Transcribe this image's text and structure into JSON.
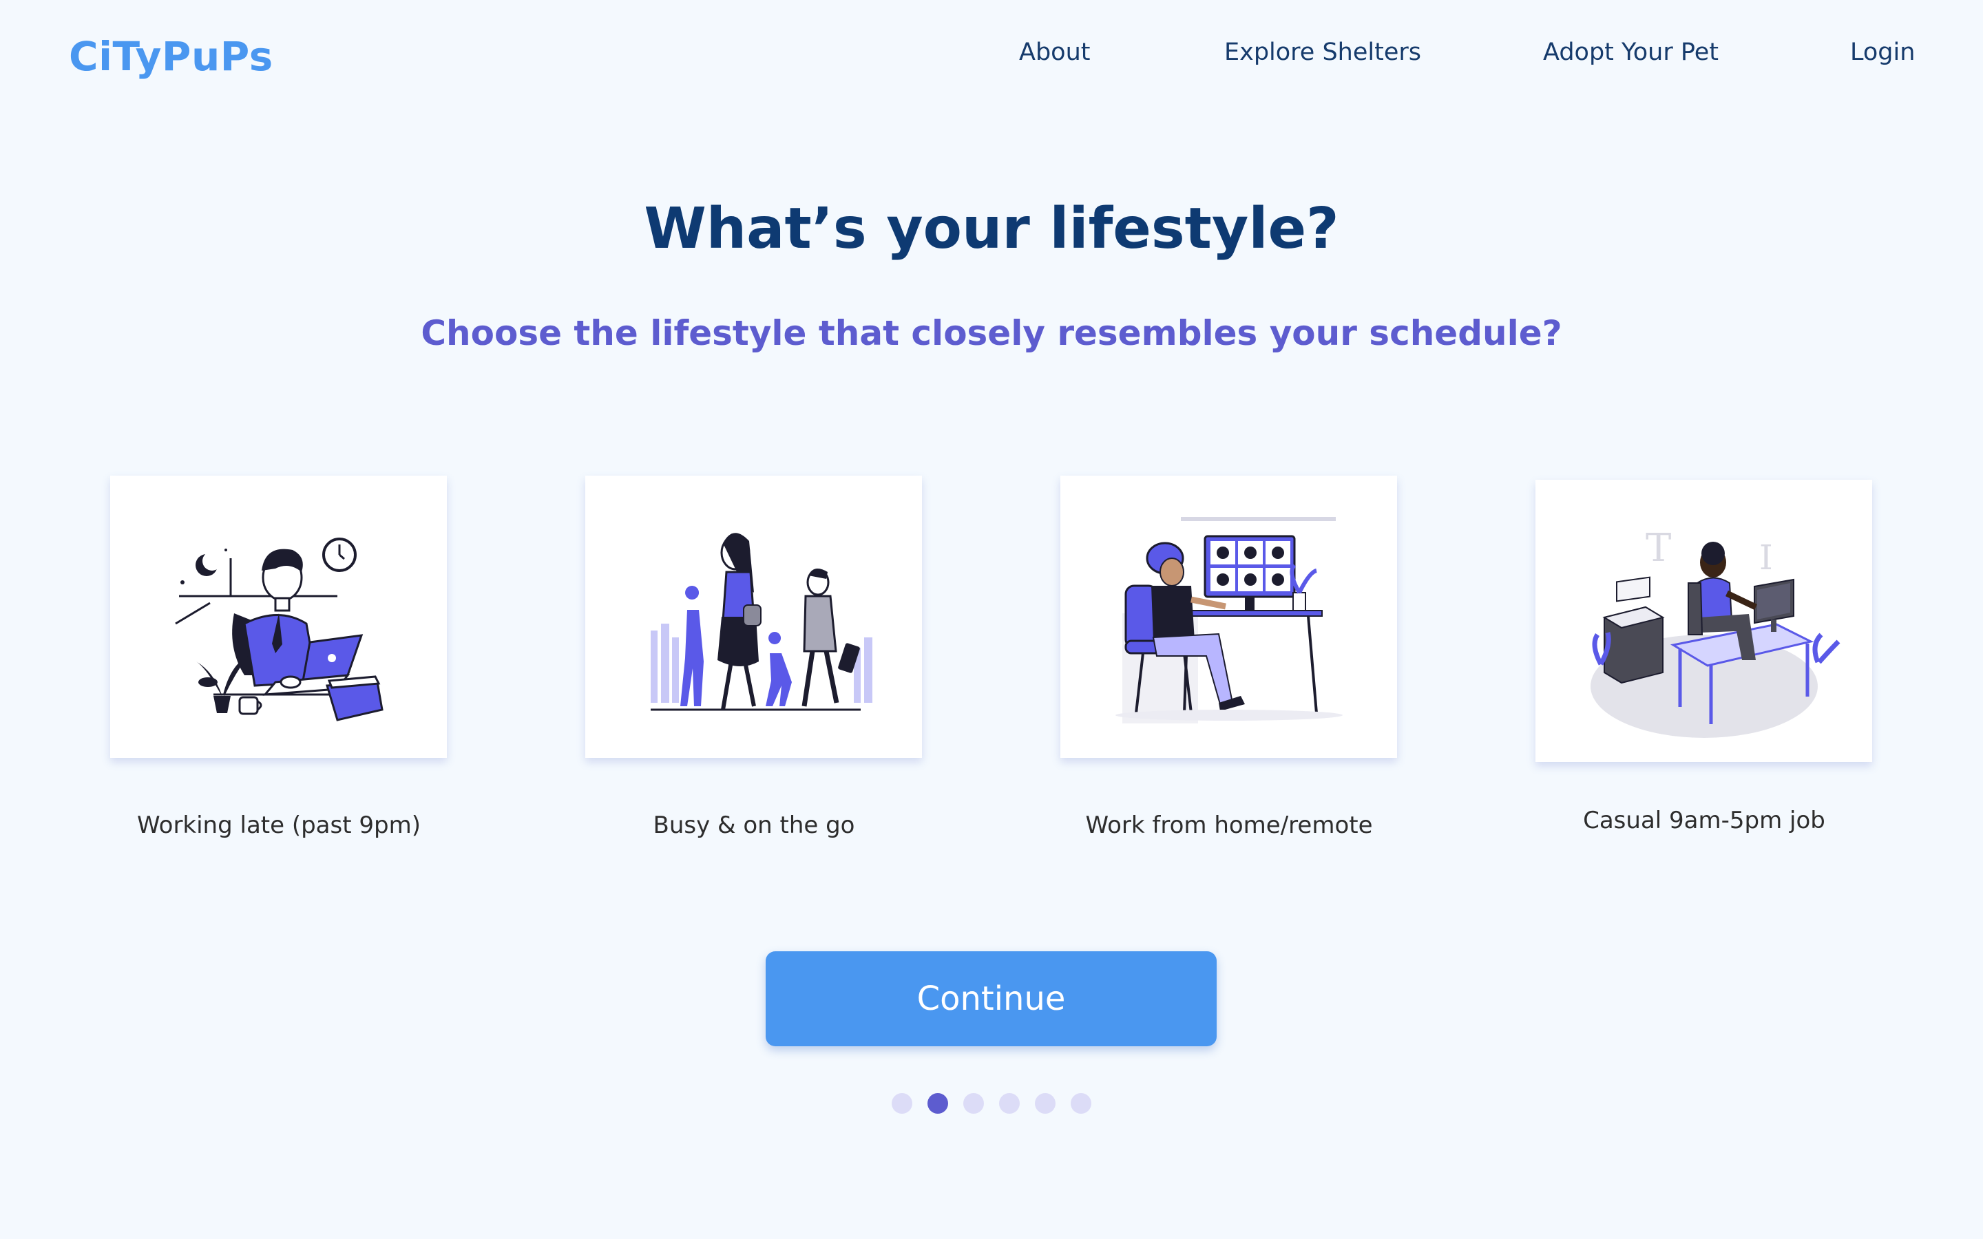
{
  "brand": "CiTyPuPs",
  "nav": {
    "about": "About",
    "explore": "Explore Shelters",
    "adopt": "Adopt Your Pet",
    "login": "Login"
  },
  "title": "What’s your lifestyle?",
  "subtitle": "Choose the lifestyle that closely resembles your schedule?",
  "options": [
    {
      "label": "Working late (past 9pm)",
      "icon": "night-worker-illustration"
    },
    {
      "label": "Busy & on the go",
      "icon": "commuters-illustration"
    },
    {
      "label": "Work from home/remote",
      "icon": "video-call-illustration"
    },
    {
      "label": "Casual 9am-5pm job",
      "icon": "office-desk-illustration"
    }
  ],
  "continue_label": "Continue",
  "pagination": {
    "total": 6,
    "current": 2
  },
  "colors": {
    "brand": "#4a97f0",
    "heading": "#0e3a72",
    "accent": "#5d5ccf",
    "background": "#f4f9fe"
  }
}
